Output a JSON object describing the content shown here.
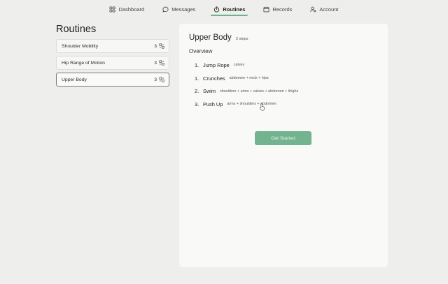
{
  "nav": {
    "items": [
      {
        "label": "Dashboard",
        "icon": "grid-icon"
      },
      {
        "label": "Messages",
        "icon": "chat-bubble-icon"
      },
      {
        "label": "Routines",
        "icon": "timer-icon"
      },
      {
        "label": "Records",
        "icon": "calendar-icon"
      },
      {
        "label": "Account",
        "icon": "user-settings-icon"
      }
    ],
    "active": "Routines",
    "active_color": "#6bb38c"
  },
  "sidebar": {
    "title": "Routines",
    "items": [
      {
        "label": "Shoulder Mobility",
        "count": "3"
      },
      {
        "label": "Hip Range of Motion",
        "count": "3"
      },
      {
        "label": "Upper Body",
        "count": "3"
      }
    ],
    "selected": "Upper Body"
  },
  "detail": {
    "title": "Upper Body",
    "steps_label": "3 steps",
    "overview_label": "Overview",
    "steps": [
      {
        "num": "1.",
        "name": "Jump Rope",
        "tags": "calves"
      },
      {
        "num": "1.",
        "name": "Crunches",
        "tags": "abdomen + neck + hips"
      },
      {
        "num": "2.",
        "name": "Swim",
        "tags": "shoulders + arms + calves + abdomen + thighs"
      },
      {
        "num": "3.",
        "name": "Push Up",
        "tags": "arms + shoulders + abdomen"
      }
    ],
    "start_button": "Get Started",
    "button_color": "#74b38f"
  }
}
